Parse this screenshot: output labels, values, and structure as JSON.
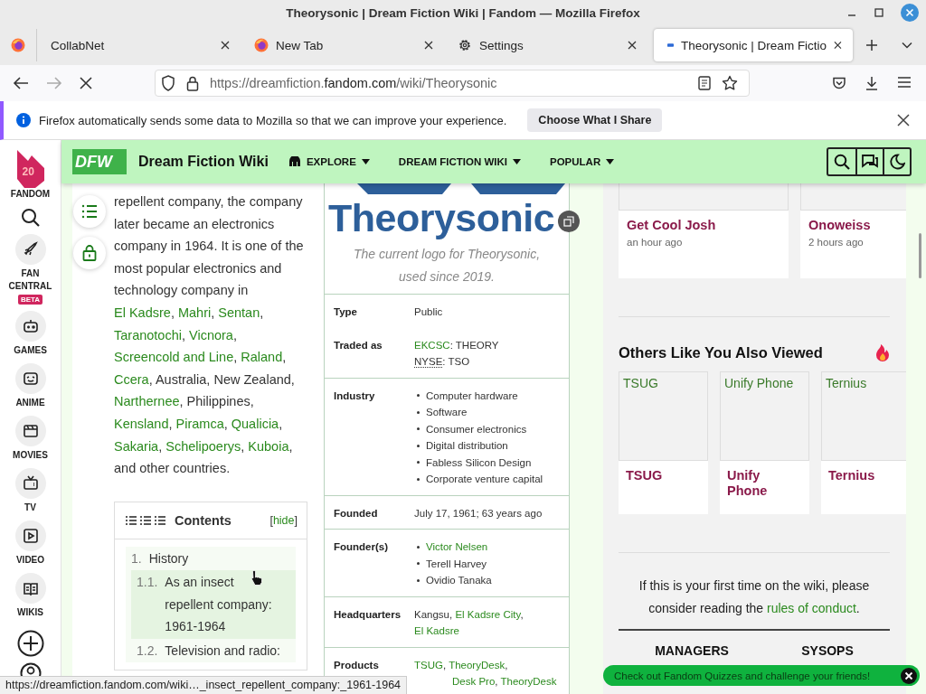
{
  "window": {
    "title": "Theorysonic | Dream Fiction Wiki | Fandom — Mozilla Firefox"
  },
  "tabs": [
    {
      "label": "CollabNet",
      "kind": "plain",
      "selected": false
    },
    {
      "label": "New Tab",
      "kind": "firefox",
      "selected": false
    },
    {
      "label": "Settings",
      "kind": "settings",
      "selected": false
    },
    {
      "label": "Theorysonic | Dream Fictio",
      "kind": "page",
      "selected": true
    }
  ],
  "toolbar": {
    "url": {
      "prefix": "https://dreamfiction.",
      "host": "fandom.com",
      "path": "/wiki/Theorysonic"
    }
  },
  "notification": {
    "message": "Firefox automatically sends some data to Mozilla so that we can improve your experience.",
    "button": "Choose What I Share"
  },
  "fandom_sidebar": {
    "logo_badge": "20",
    "logo_label": "FANDOM",
    "items": [
      {
        "label": "FAN CENTRAL",
        "kind": "rocket",
        "badge": "BETA"
      },
      {
        "label": "GAMES",
        "kind": "games"
      },
      {
        "label": "ANIME",
        "kind": "anime"
      },
      {
        "label": "MOVIES",
        "kind": "movies"
      },
      {
        "label": "TV",
        "kind": "tv"
      },
      {
        "label": "VIDEO",
        "kind": "video"
      },
      {
        "label": "WIKIS",
        "kind": "wikis"
      }
    ]
  },
  "wiki_header": {
    "logo": "DFW",
    "title": "Dream Fiction Wiki",
    "nav": [
      {
        "label": "EXPLORE",
        "kind": "icon"
      },
      {
        "label": "DREAM FICTION WIKI",
        "kind": "plain"
      },
      {
        "label": "POPULAR",
        "kind": "plain"
      }
    ]
  },
  "article": {
    "paragraph": [
      {
        "text": "repellent company, the company later became an electronics company in 1964. It is one of the most popular electronics and technology company in ",
        "kind": "text"
      },
      {
        "text": "El Kadsre",
        "kind": "link"
      },
      {
        "text": ", ",
        "kind": "text"
      },
      {
        "text": "Mahri",
        "kind": "link"
      },
      {
        "text": ", ",
        "kind": "text"
      },
      {
        "text": "Sentan",
        "kind": "link"
      },
      {
        "text": ", ",
        "kind": "text"
      },
      {
        "text": "Taranotochi",
        "kind": "link"
      },
      {
        "text": ", ",
        "kind": "text"
      },
      {
        "text": "Vicnora",
        "kind": "link"
      },
      {
        "text": ", ",
        "kind": "text"
      },
      {
        "text": "Screencold and Line",
        "kind": "link"
      },
      {
        "text": ", ",
        "kind": "text"
      },
      {
        "text": "Raland",
        "kind": "link"
      },
      {
        "text": ", ",
        "kind": "text"
      },
      {
        "text": "Ccera",
        "kind": "link"
      },
      {
        "text": ", Australia, New Zealand, ",
        "kind": "text"
      },
      {
        "text": "Narthernee",
        "kind": "link"
      },
      {
        "text": ", Philippines, ",
        "kind": "text"
      },
      {
        "text": "Kensland",
        "kind": "link"
      },
      {
        "text": ", ",
        "kind": "text"
      },
      {
        "text": "Piramca",
        "kind": "link"
      },
      {
        "text": ", ",
        "kind": "text"
      },
      {
        "text": "Qualicia",
        "kind": "link"
      },
      {
        "text": ", ",
        "kind": "text"
      },
      {
        "text": "Sakaria",
        "kind": "link"
      },
      {
        "text": ", ",
        "kind": "text"
      },
      {
        "text": "Schelipoerys",
        "kind": "link"
      },
      {
        "text": ", ",
        "kind": "text"
      },
      {
        "text": "Kuboia",
        "kind": "link"
      },
      {
        "text": ", and other countries.",
        "kind": "text"
      }
    ]
  },
  "contents": {
    "title": "Contents",
    "toggle": {
      "open": "[",
      "label": "hide",
      "close": "]"
    },
    "items": [
      {
        "number": "1.",
        "label": "History",
        "highlighted": false,
        "children": [
          {
            "number": "1.1.",
            "label": "As an insect repellent company: 1961-1964",
            "highlighted": true
          },
          {
            "number": "1.2.",
            "label": "Television and radio:",
            "highlighted": false
          }
        ]
      }
    ]
  },
  "infobox": {
    "logo_text": "Theorysonic",
    "caption": "The current logo for Theorysonic, used since 2019.",
    "rows": [
      {
        "label": "Type",
        "kind": "lines",
        "items": [
          [
            {
              "text": "Public",
              "kind": "text"
            }
          ]
        ]
      },
      {
        "label": "Traded as",
        "kind": "lines",
        "items": [
          [
            {
              "text": "EKCSC",
              "kind": "link"
            },
            {
              "text": ": THEORY",
              "kind": "text"
            }
          ],
          [
            {
              "text": "NYSE",
              "kind": "abbr"
            },
            {
              "text": ": TSO",
              "kind": "text"
            }
          ]
        ]
      },
      {
        "label": "Industry",
        "kind": "bullets",
        "items": [
          [
            {
              "text": "Computer hardware",
              "kind": "text"
            }
          ],
          [
            {
              "text": "Software",
              "kind": "text"
            }
          ],
          [
            {
              "text": "Consumer electronics",
              "kind": "text"
            }
          ],
          [
            {
              "text": "Digital distribution",
              "kind": "text"
            }
          ],
          [
            {
              "text": "Fabless Silicon Design",
              "kind": "text"
            }
          ],
          [
            {
              "text": "Corporate venture capital",
              "kind": "text"
            }
          ]
        ]
      },
      {
        "label": "Founded",
        "kind": "lines",
        "items": [
          [
            {
              "text": "July 17, 1961; 63 years ago",
              "kind": "text"
            }
          ]
        ]
      },
      {
        "label": "Founder(s)",
        "kind": "bullets",
        "items": [
          [
            {
              "text": "Victor Nelsen",
              "kind": "link"
            }
          ],
          [
            {
              "text": "Terell Harvey",
              "kind": "text"
            }
          ],
          [
            {
              "text": "Ovidio Tanaka",
              "kind": "text"
            }
          ]
        ]
      },
      {
        "label": "Headquarters",
        "kind": "lines",
        "items": [
          [
            {
              "text": "Kangsu, ",
              "kind": "text"
            },
            {
              "text": "El Kadsre City",
              "kind": "link"
            },
            {
              "text": ", ",
              "kind": "text"
            },
            {
              "text": "El Kadsre",
              "kind": "link"
            }
          ]
        ]
      },
      {
        "label": "Products",
        "kind": "lines",
        "items": [
          [
            {
              "text": "TSUG",
              "kind": "link"
            },
            {
              "text": ", ",
              "kind": "text"
            },
            {
              "text": "TheoryDesk",
              "kind": "link"
            },
            {
              "text": ",",
              "kind": "text"
            }
          ],
          [
            {
              "text": "Desk Pro",
              "kind": "link"
            },
            {
              "text": ", ",
              "kind": "text"
            },
            {
              "text": "TheoryDesk",
              "kind": "link"
            }
          ]
        ]
      }
    ]
  },
  "rail": {
    "recent": [
      {
        "title": "Get Cool Josh",
        "time": "an hour ago"
      },
      {
        "title": "Onoweiss",
        "time": "2 hours ago"
      }
    ],
    "also_viewed": {
      "title": "Others Like You Also Viewed",
      "items": [
        {
          "image_alt": "TSUG",
          "title": "TSUG"
        },
        {
          "image_alt": "Unify Phone",
          "title": "Unify Phone"
        },
        {
          "image_alt": "Ternius",
          "title": "Ternius"
        }
      ]
    },
    "welcome": [
      {
        "text": "If this is your first time on the wiki, please consider reading the ",
        "kind": "text"
      },
      {
        "text": "rules of conduct",
        "kind": "link"
      },
      {
        "text": ".",
        "kind": "text"
      }
    ],
    "staff": [
      "MANAGERS",
      "SYSOPS"
    ]
  },
  "toast": "Check out Fandom Quizzes and challenge your friends!",
  "status_bar": "https://dreamfiction.fandom.com/wiki…_insect_repellent_company:_1961-1964"
}
